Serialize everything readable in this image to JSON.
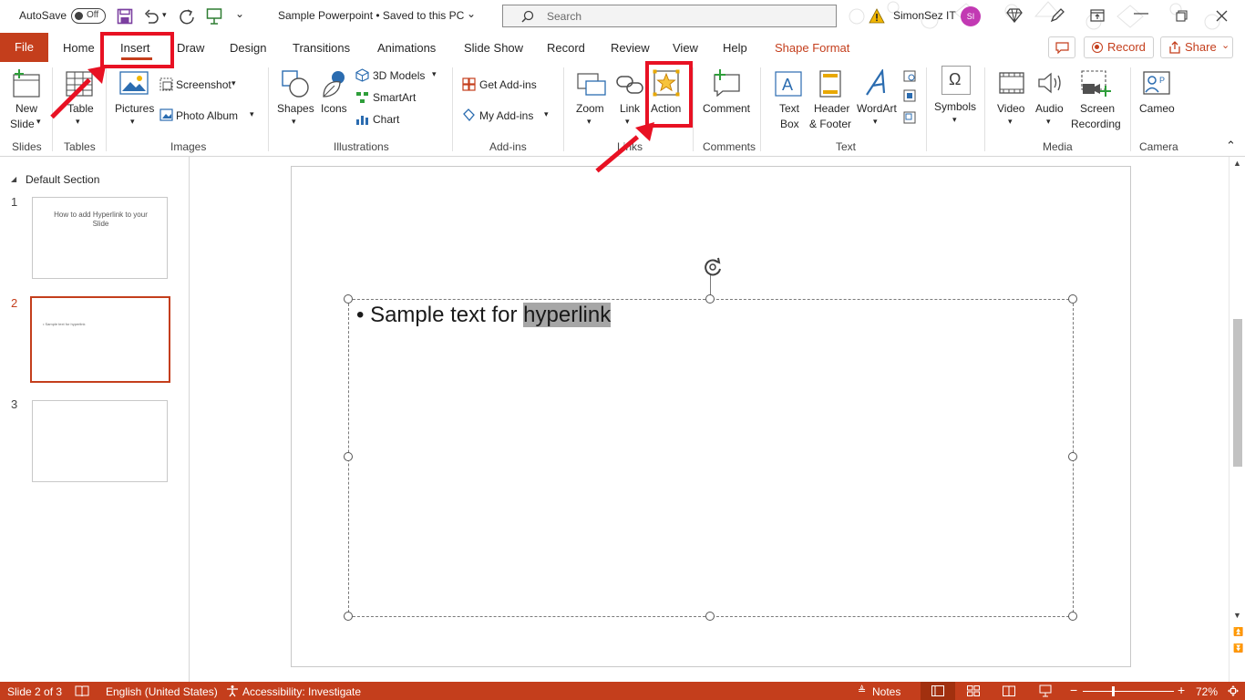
{
  "titlebar": {
    "autosave_label": "AutoSave",
    "autosave_state": "Off",
    "doc_title": "Sample Powerpoint  •  Saved to this PC",
    "search_placeholder": "Search",
    "user_name": "SimonSez IT",
    "user_initials": "SI"
  },
  "tabs": {
    "file": "File",
    "items": [
      "Home",
      "Insert",
      "Draw",
      "Design",
      "Transitions",
      "Animations",
      "Slide Show",
      "Record",
      "Review",
      "View",
      "Help",
      "Shape Format"
    ],
    "active": "Insert",
    "record_button": "Record",
    "share_button": "Share"
  },
  "ribbon": {
    "slides": {
      "new_slide": [
        "New",
        "Slide"
      ],
      "group": "Slides"
    },
    "tables": {
      "table": "Table",
      "group": "Tables"
    },
    "images": {
      "pictures": "Pictures",
      "screenshot": "Screenshot",
      "photo_album": "Photo Album",
      "group": "Images"
    },
    "illustrations": {
      "shapes": "Shapes",
      "icons": "Icons",
      "models3d": "3D Models",
      "smartart": "SmartArt",
      "chart": "Chart",
      "group": "Illustrations"
    },
    "addins": {
      "get": "Get Add-ins",
      "my": "My Add-ins",
      "group": "Add-ins"
    },
    "links": {
      "zoom": "Zoom",
      "link": "Link",
      "action": "Action",
      "group": "Links"
    },
    "comments": {
      "comment": "Comment",
      "group": "Comments"
    },
    "text": {
      "textbox": [
        "Text",
        "Box"
      ],
      "header": [
        "Header",
        "& Footer"
      ],
      "wordart": "WordArt",
      "group": "Text"
    },
    "symbols": {
      "symbols": "Symbols"
    },
    "media": {
      "video": "Video",
      "audio": "Audio",
      "screen": [
        "Screen",
        "Recording"
      ],
      "group": "Media"
    },
    "camera": {
      "cameo": "Cameo",
      "group": "Camera"
    }
  },
  "thumbnails": {
    "section": "Default Section",
    "slides": [
      {
        "num": "1",
        "text": "How to add Hyperlink to your Slide"
      },
      {
        "num": "2",
        "text": "• Sample text for hyperlink"
      },
      {
        "num": "3",
        "text": ""
      }
    ],
    "selected": 2
  },
  "slide": {
    "text_plain": "Sample text for ",
    "text_selected": "hyperlink"
  },
  "statusbar": {
    "slide_info": "Slide 2 of 3",
    "language": "English (United States)",
    "accessibility": "Accessibility: Investigate",
    "notes": "Notes",
    "zoom": "72%"
  },
  "colors": {
    "accent": "#c43e1c",
    "highlight": "#e81123",
    "shape_format": "#c43e1c"
  }
}
